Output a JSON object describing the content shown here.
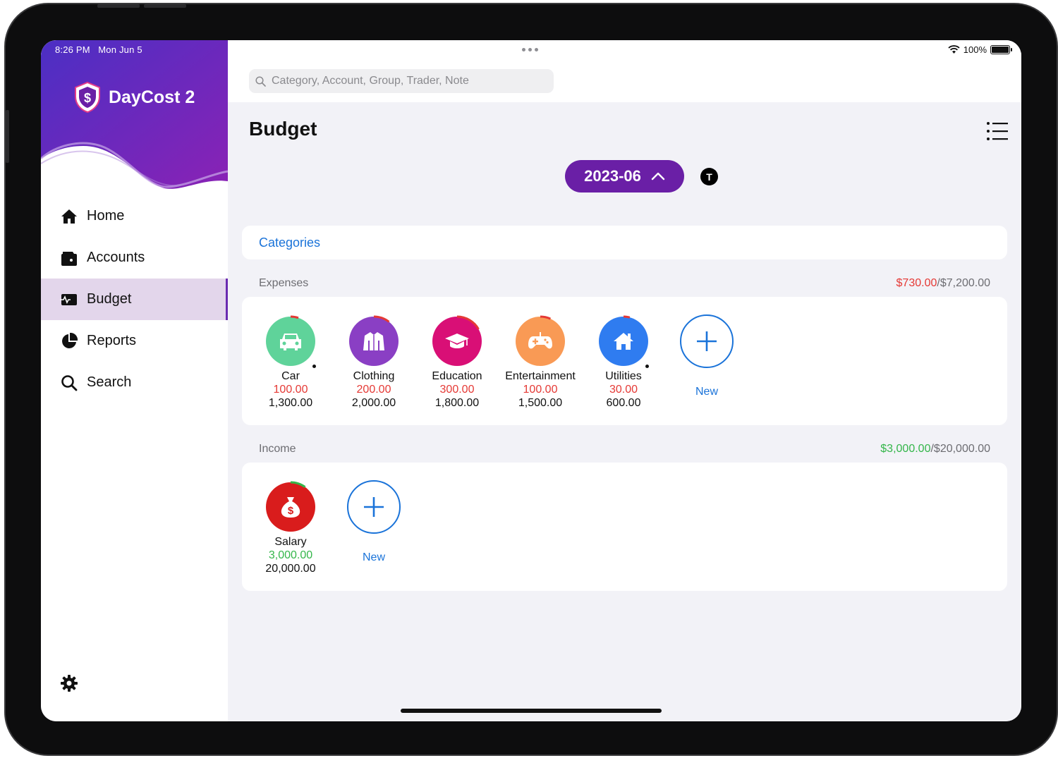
{
  "status_bar": {
    "time": "8:26 PM",
    "date": "Mon Jun 5",
    "battery": "100%"
  },
  "app": {
    "name": "DayCost 2"
  },
  "sidebar": {
    "items": [
      {
        "label": "Home",
        "icon": "home-icon"
      },
      {
        "label": "Accounts",
        "icon": "wallet-icon"
      },
      {
        "label": "Budget",
        "icon": "budget-icon",
        "active": true
      },
      {
        "label": "Reports",
        "icon": "pie-chart-icon"
      },
      {
        "label": "Search",
        "icon": "search-icon"
      }
    ],
    "settings_icon": "gear-icon"
  },
  "search": {
    "placeholder": "Category, Account, Group, Trader, Note",
    "value": ""
  },
  "page": {
    "title": "Budget",
    "month": "2023-06",
    "badge": "T"
  },
  "categories_link": "Categories",
  "expenses": {
    "label": "Expenses",
    "total_spent": "$730.00",
    "total_budget": "/$7,200.00",
    "items": [
      {
        "name": "Car",
        "spent": "100.00",
        "budget": "1,300.00",
        "color": "#5fd39a",
        "icon": "car-icon"
      },
      {
        "name": "Clothing",
        "spent": "200.00",
        "budget": "2,000.00",
        "color": "#8a3fc4",
        "icon": "jacket-icon"
      },
      {
        "name": "Education",
        "spent": "300.00",
        "budget": "1,800.00",
        "color": "#d90f76",
        "icon": "graduation-cap-icon"
      },
      {
        "name": "Entertainment",
        "spent": "100.00",
        "budget": "1,500.00",
        "color": "#f99a55",
        "icon": "gamepad-icon"
      },
      {
        "name": "Utilities",
        "spent": "30.00",
        "budget": "600.00",
        "color": "#2f7cf0",
        "icon": "house-icon"
      }
    ],
    "new_label": "New"
  },
  "income": {
    "label": "Income",
    "total_earned": "$3,000.00",
    "total_budget": "/$20,000.00",
    "items": [
      {
        "name": "Salary",
        "earned": "3,000.00",
        "budget": "20,000.00",
        "color": "#d91c1c",
        "icon": "money-bag-icon"
      }
    ],
    "new_label": "New"
  },
  "colors": {
    "accent": "#6a1fa6",
    "link": "#1a73d9",
    "expense": "#e53935",
    "income": "#34b64a"
  }
}
